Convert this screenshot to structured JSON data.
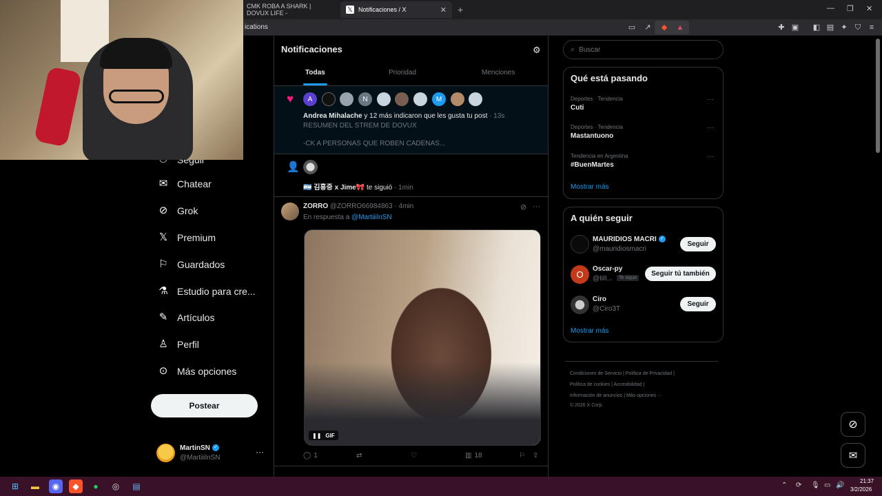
{
  "browser": {
    "tabs": [
      {
        "title": "CMK ROBA A SHARK | DOVUX LIFE -"
      },
      {
        "title": "Notificaciones / X"
      }
    ],
    "url_fragment": "ications"
  },
  "nav": {
    "items": [
      {
        "label": "Seguir",
        "icon": "follow-icon"
      },
      {
        "label": "Chatear",
        "icon": "envelope-icon"
      },
      {
        "label": "Grok",
        "icon": "grok-icon"
      },
      {
        "label": "Premium",
        "icon": "x-icon"
      },
      {
        "label": "Guardados",
        "icon": "bookmark-icon"
      },
      {
        "label": "Estudio para cre...",
        "icon": "studio-icon"
      },
      {
        "label": "Artículos",
        "icon": "article-icon"
      },
      {
        "label": "Perfil",
        "icon": "person-icon"
      },
      {
        "label": "Más opciones",
        "icon": "more-icon"
      }
    ],
    "post_button": "Postear",
    "account": {
      "name": "MartinSN",
      "handle": "@MartiiilnSN"
    }
  },
  "notifications": {
    "title": "Notificaciones",
    "tabs": [
      "Todas",
      "Prioridad",
      "Menciones"
    ],
    "like": {
      "actor": "Andrea Mihalache",
      "text": " y 12 más indicaron que les gusta tu post",
      "time": " · 13s",
      "post_line1": "RESUMEN DEL STREM DE DOVUX",
      "post_line2": "-CK A PERSONAS QUE ROBEN CADENAS...",
      "avatars": [
        "A",
        "",
        "",
        "N",
        "",
        "",
        "",
        "M",
        "",
        ""
      ]
    },
    "follow": {
      "name": "🇦🇷 김홍중 x Jime🎀",
      "text": " te siguió",
      "time": " · 1min"
    },
    "tweet": {
      "name": "ZORRO",
      "handle": "@ZORRO66984863",
      "time": " · 4min",
      "reply_prefix": "En respuesta a ",
      "reply_to": "@MartiiilnSN",
      "gif_label": "GIF",
      "replies": "1",
      "views": "18"
    }
  },
  "search": {
    "placeholder": "Buscar"
  },
  "trends": {
    "title": "Qué está pasando",
    "items": [
      {
        "meta": "Deportes · Tendencia",
        "name": "Cuti"
      },
      {
        "meta": "Deportes · Tendencia",
        "name": "Mastantuono"
      },
      {
        "meta": "Tendencia en Argentina",
        "name": "#BuenMartes"
      }
    ],
    "show_more": "Mostrar más"
  },
  "who_to_follow": {
    "title": "A quién seguir",
    "items": [
      {
        "name": "MAURIDIOS MACRI",
        "handle": "@mauridiosmacri",
        "button": "Seguir",
        "verified": true
      },
      {
        "name": "Oscar-py",
        "handle": "@tiII...",
        "button": "Seguir tú también",
        "badge": "Te sigue"
      },
      {
        "name": "Ciro",
        "handle": "@Ciro3T",
        "button": "Seguir"
      }
    ],
    "show_more": "Mostrar más"
  },
  "footer": {
    "line1": "Condiciones de Servicio  |  Política de Privacidad  |",
    "line2": "Política de cookies  |  Accesibilidad  |",
    "line3": "Información de anuncios  |  Más opciones ···",
    "line4": "© 2026 X Corp."
  },
  "taskbar": {
    "time": "21:37",
    "date": "3/2/2026"
  },
  "colors": {
    "accent": "#1d9bf0",
    "like": "#f91880",
    "background": "#000000"
  }
}
